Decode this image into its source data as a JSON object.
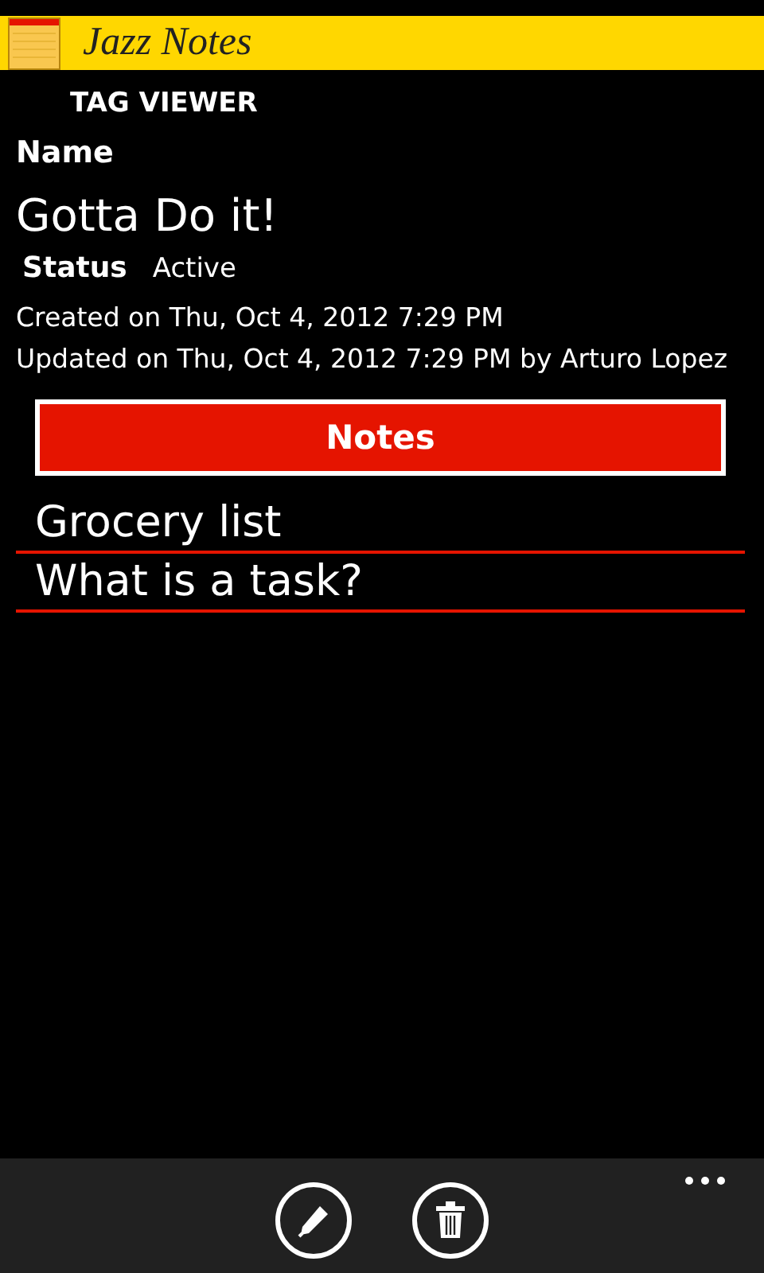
{
  "header": {
    "title": "Jazz Notes"
  },
  "page_title": "TAG VIEWER",
  "name_label": "Name",
  "name_value": "Gotta Do it!",
  "status": {
    "label": "Status",
    "value": "Active"
  },
  "created": "Created on Thu, Oct 4, 2012  7:29 PM",
  "updated": "Updated on Thu, Oct 4, 2012  7:29 PM by Arturo Lopez",
  "notes_button": "Notes",
  "notes": [
    {
      "title": "Grocery list"
    },
    {
      "title": "What is a task?"
    }
  ],
  "app_bar": {
    "buttons": [
      {
        "kind": "edit"
      },
      {
        "kind": "delete"
      }
    ]
  }
}
